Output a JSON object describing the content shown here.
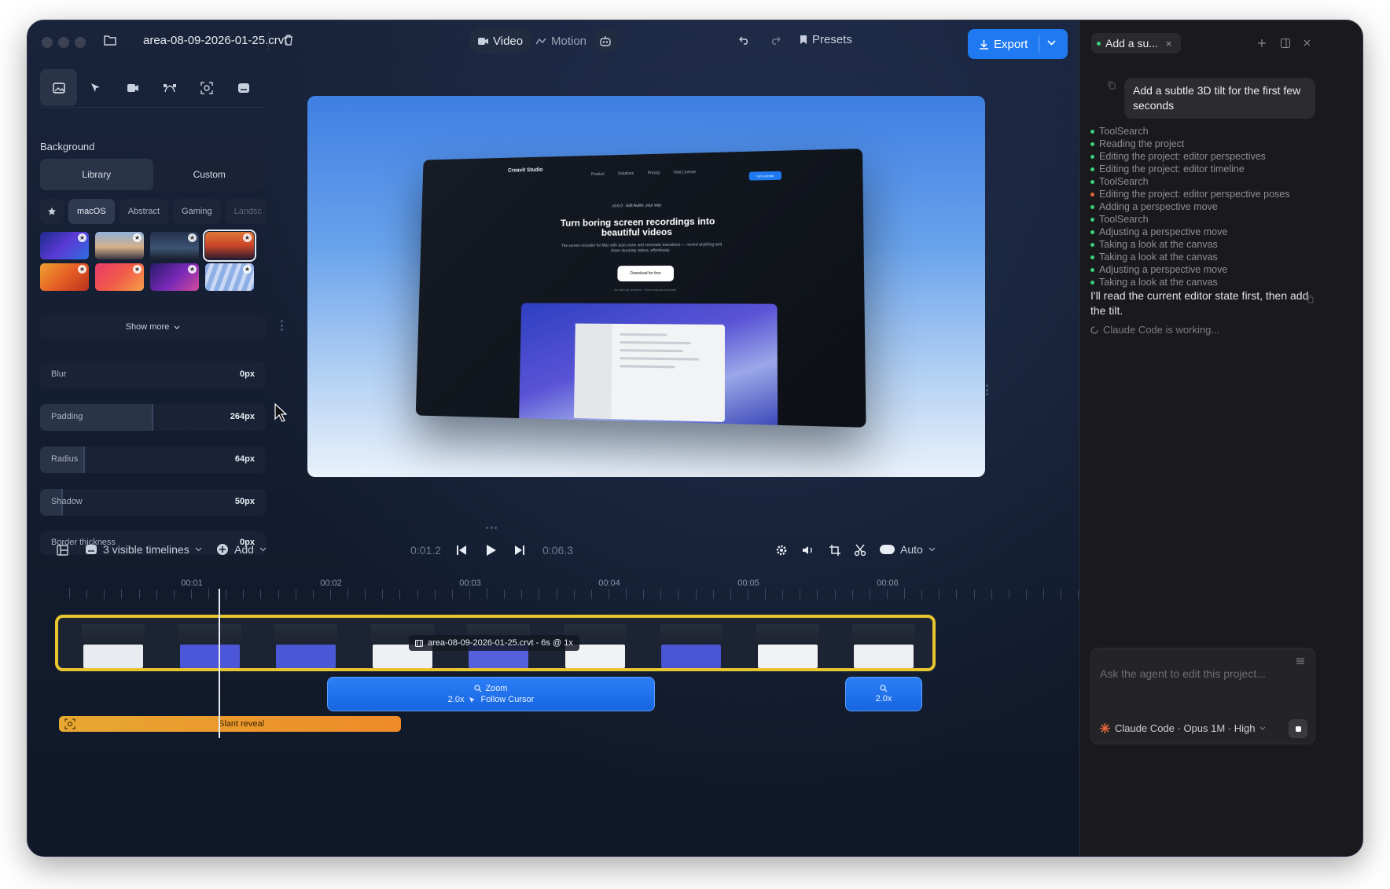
{
  "toolbar": {
    "filename": "area-08-09-2026-01-25.crvt",
    "mode_video": "Video",
    "mode_motion": "Motion",
    "presets": "Presets",
    "export": "Export"
  },
  "left_panel": {
    "section": "Background",
    "tabs": [
      "Library",
      "Custom"
    ],
    "categories": [
      "macOS",
      "Abstract",
      "Gaming",
      "Landsc"
    ],
    "show_more": "Show more",
    "sliders": [
      {
        "label": "Blur",
        "value": "0px",
        "level": 0
      },
      {
        "label": "Padding",
        "value": "264px",
        "level": 0.5
      },
      {
        "label": "Radius",
        "value": "64px",
        "level": 0.2
      },
      {
        "label": "Shadow",
        "value": "50px",
        "level": 0.1
      },
      {
        "label": "Border thickness",
        "value": "0px",
        "level": 0
      }
    ]
  },
  "canvas": {
    "brand": "Creavit Studio",
    "nav": [
      "Product",
      "Solutions",
      "Pricing",
      "Find License"
    ],
    "cta": "Get License",
    "badge": "v3.6.0 · Edit Audio, your way",
    "headline": "Turn boring screen recordings into beautiful videos",
    "subhead": "The screen recorder for Mac with auto zoom and cinematic transitions — record anything and share stunning videos, effortlessly.",
    "download": "Download for free",
    "note": "No sign-up required · 6 free exports included"
  },
  "timeline": {
    "visible": "3 visible timelines",
    "add": "Add",
    "current_time": "0:01.2",
    "total_time": "0:06.3",
    "auto": "Auto",
    "ruler": [
      "00:01",
      "00:02",
      "00:03",
      "00:04",
      "00:05",
      "00:06"
    ],
    "clip_label": "area-08-09-2026-01-25.crvt - 6s @ 1x",
    "zoom1_title": "Zoom",
    "zoom1_detail": "2.0x",
    "zoom1_follow": "Follow Cursor",
    "zoom2_detail": "2.0x",
    "slant": "Slant reveal"
  },
  "agent": {
    "tab_title": "Add a su...",
    "user_message": "Add a subtle 3D tilt for the first few seconds",
    "steps": [
      "ToolSearch",
      "Reading the project",
      "Editing the project: editor perspectives",
      "Editing the project: editor timeline",
      "ToolSearch",
      "Editing the project: editor perspective poses",
      "Adding a perspective move",
      "ToolSearch",
      "Adjusting a perspective move",
      "Taking a look at the canvas",
      "Taking a look at the canvas",
      "Adjusting a perspective move",
      "Taking a look at the canvas"
    ],
    "step_colors": [
      "#3ccf7a",
      "#3ccf7a",
      "#3ccf7a",
      "#3ccf7a",
      "#3ccf7a",
      "#e0663c",
      "#3ccf7a",
      "#3ccf7a",
      "#3ccf7a",
      "#3ccf7a",
      "#3ccf7a",
      "#3ccf7a",
      "#3ccf7a"
    ],
    "reply": "I'll read the current editor state first, then add the tilt.",
    "working": "Claude Code is working...",
    "placeholder": "Ask the agent to edit this project...",
    "model": "Claude Code · Opus 1M · High"
  },
  "colors": {
    "accent": "#1f7af2",
    "clip_border": "#e7c52f",
    "slant": "#e7a832"
  }
}
